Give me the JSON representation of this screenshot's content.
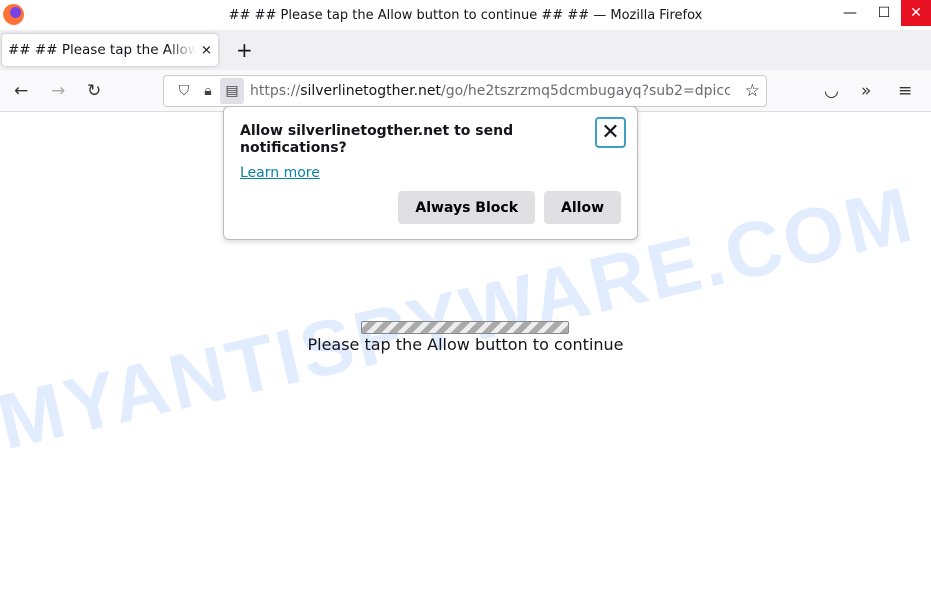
{
  "window": {
    "title": "## ## Please tap the Allow button to continue ## ## — Mozilla Firefox"
  },
  "tab": {
    "title": "## ## Please tap the Allow button to continue ## ##",
    "close": "×",
    "new_tab": "+"
  },
  "urlbar": {
    "scheme": "https://",
    "domain": "silverlinetogther.net",
    "path": "/go/he2tszrzmq5dcmbugayq?sub2=dpicc"
  },
  "popup": {
    "title": "Allow silverlinetogther.net to send notifications?",
    "learn_more": "Learn more",
    "block": "Always Block",
    "allow": "Allow"
  },
  "page": {
    "message": "Please tap the Allow button to continue"
  },
  "watermark": "MYANTISPYWARE.COM"
}
